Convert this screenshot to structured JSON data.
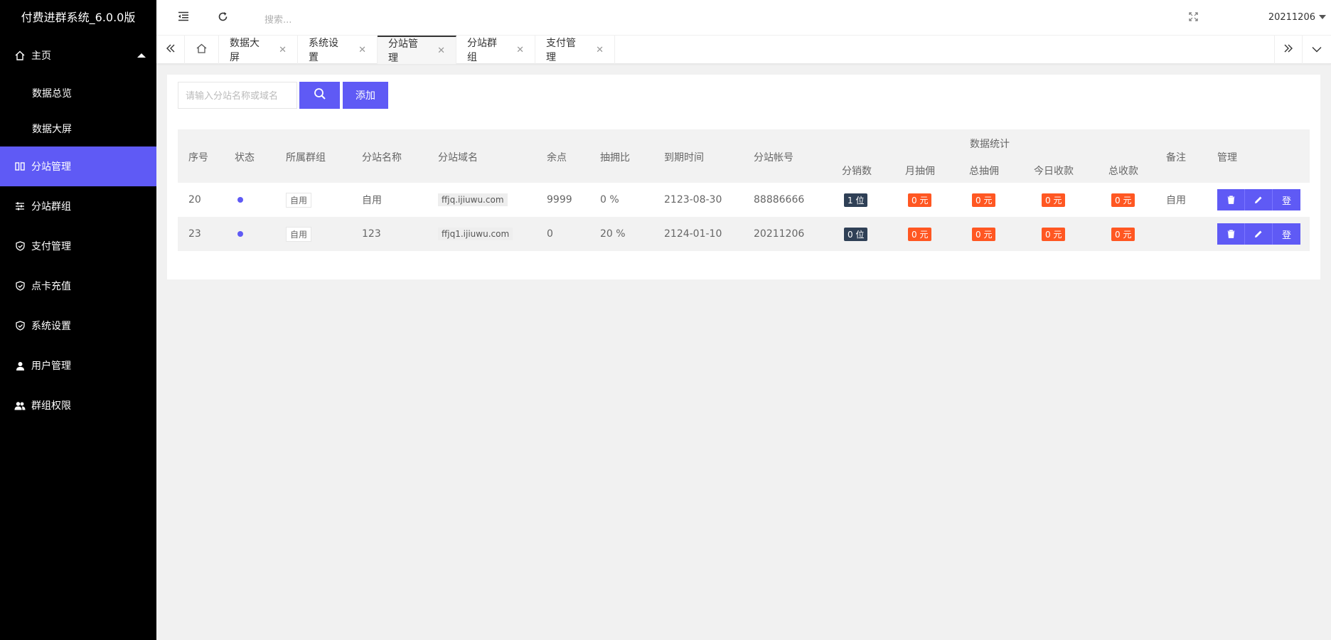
{
  "app": {
    "title": "付费进群系统_6.0.0版"
  },
  "sidebar": {
    "home": {
      "label": "主页",
      "icon": "home-icon"
    },
    "sub_items": [
      {
        "label": "数据总览"
      },
      {
        "label": "数据大屏"
      }
    ],
    "items": [
      {
        "label": "分站管理",
        "icon": "columns-icon",
        "active": true
      },
      {
        "label": "分站群组",
        "icon": "sliders-icon"
      },
      {
        "label": "支付管理",
        "icon": "shield-icon"
      },
      {
        "label": "点卡充值",
        "icon": "shield-icon"
      },
      {
        "label": "系统设置",
        "icon": "shield-icon"
      },
      {
        "label": "用户管理",
        "icon": "user-icon"
      },
      {
        "label": "群组权限",
        "icon": "users-icon"
      }
    ]
  },
  "header": {
    "search_placeholder": "搜索...",
    "user": "20211206"
  },
  "tabs": [
    {
      "label": "数据大屏"
    },
    {
      "label": "系统设置"
    },
    {
      "label": "分站管理",
      "active": true
    },
    {
      "label": "分站群组"
    },
    {
      "label": "支付管理"
    }
  ],
  "toolbar": {
    "search_placeholder": "请输入分站名称或域名",
    "add_label": "添加"
  },
  "table": {
    "headers": {
      "id": "序号",
      "status": "状态",
      "group": "所属群组",
      "name": "分站名称",
      "domain": "分站域名",
      "balance": "余点",
      "rate": "抽拥比",
      "expire": "到期时间",
      "account": "分站帐号",
      "stats": "数据统计",
      "sales": "分销数",
      "month": "月抽佣",
      "total": "总抽佣",
      "today": "今日收款",
      "income": "总收款",
      "note": "备注",
      "manage": "管理"
    },
    "rows": [
      {
        "id": "20",
        "group": "自用",
        "name": "自用",
        "domain": "ffjq.ijiuwu.com",
        "balance": "9999",
        "rate": "0 %",
        "expire": "2123-08-30",
        "account": "88886666",
        "sales": "1 位",
        "month": "0 元",
        "total": "0 元",
        "today": "0 元",
        "income": "0 元",
        "note": "自用",
        "login": "登"
      },
      {
        "id": "23",
        "group": "自用",
        "name": "123",
        "domain": "ffjq1.ijiuwu.com",
        "balance": "0",
        "rate": "20 %",
        "expire": "2124-01-10",
        "account": "20211206",
        "sales": "0 位",
        "month": "0 元",
        "total": "0 元",
        "today": "0 元",
        "income": "0 元",
        "note": "",
        "login": "登"
      }
    ]
  },
  "colors": {
    "accent": "#5f5af5",
    "sidebar_bg": "#000000",
    "badge_red": "#ff5722",
    "badge_dark": "#2f4056"
  }
}
